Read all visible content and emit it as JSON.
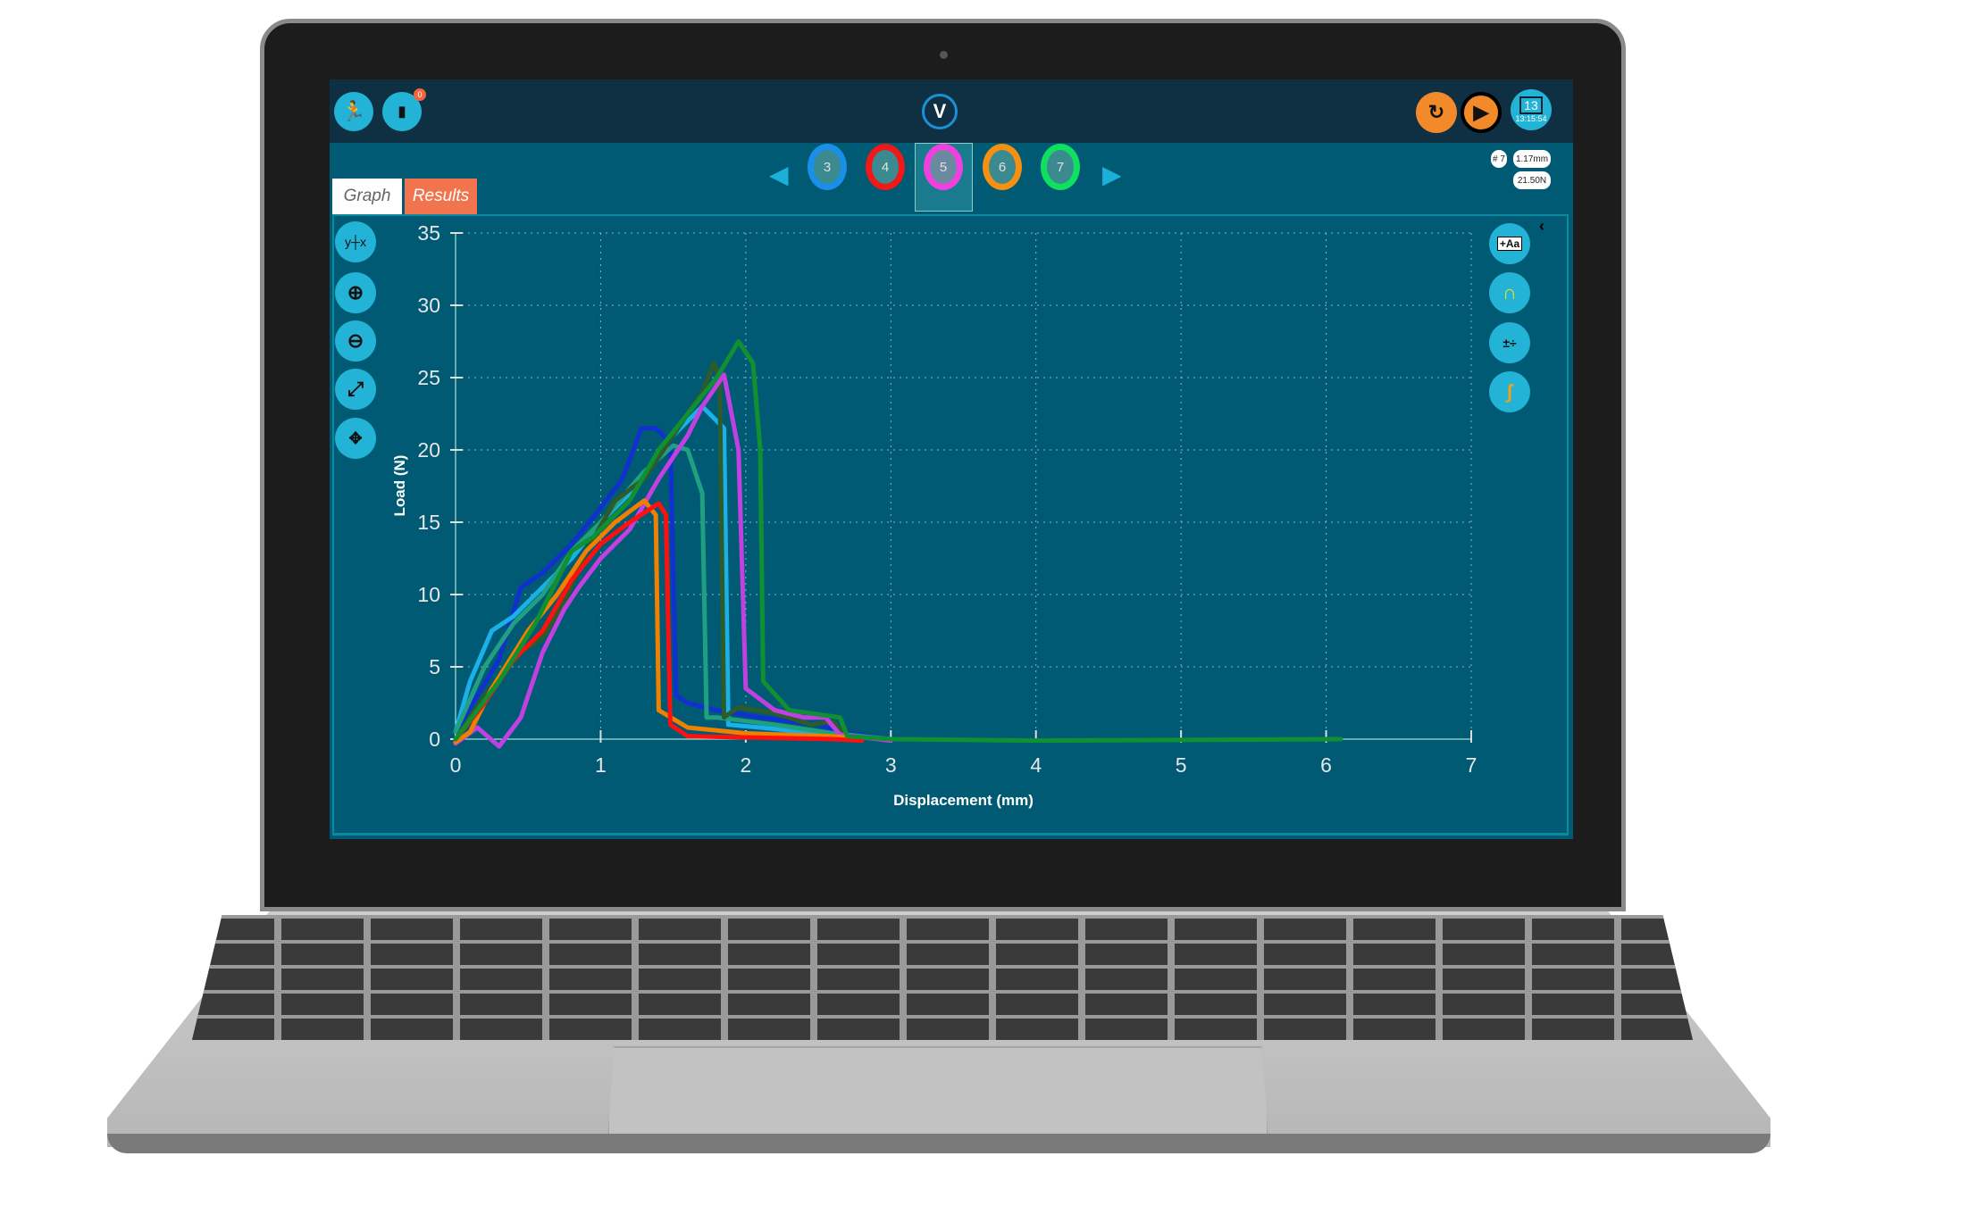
{
  "header": {
    "left_icons": [
      "exit-icon",
      "usb-device-icon"
    ],
    "notification_count": "0",
    "logo_letter": "V",
    "right_icons": [
      "reset-icon",
      "play-icon",
      "calendar-icon"
    ],
    "date_day": "13",
    "time": "13:15:54",
    "accent_orange": "#f28a2a",
    "accent_cyan": "#22b3d6"
  },
  "samples": {
    "items": [
      {
        "label": "3",
        "color": "#1a8fe8"
      },
      {
        "label": "4",
        "color": "#f01818"
      },
      {
        "label": "5",
        "color": "#f040e0",
        "selected": true
      },
      {
        "label": "6",
        "color": "#f59010"
      },
      {
        "label": "7",
        "color": "#10e060"
      }
    ]
  },
  "readout": {
    "sample": "# 7",
    "displacement": "1.17mm",
    "load": "21.50N"
  },
  "tabs": [
    {
      "label": "Graph",
      "active": true
    },
    {
      "label": "Results",
      "active": false
    }
  ],
  "left_tools": [
    "axis-select-icon",
    "zoom-in-icon",
    "zoom-out-icon",
    "fit-expand-icon",
    "pan-icon"
  ],
  "right_tools": [
    "annotate-text-icon",
    "curve-fit-icon",
    "calculator-icon",
    "overlay-curves-icon"
  ],
  "chart_data": {
    "type": "line",
    "xlabel": "Displacement (mm)",
    "ylabel": "Load (N)",
    "xlim": [
      0,
      7
    ],
    "ylim": [
      0,
      35
    ],
    "xticks": [
      0,
      1,
      2,
      3,
      4,
      5,
      6,
      7
    ],
    "yticks": [
      0,
      5,
      10,
      15,
      20,
      25,
      30,
      35
    ],
    "grid": true,
    "series": [
      {
        "color": "#1030d0",
        "points": [
          [
            0,
            0.5
          ],
          [
            0.15,
            3
          ],
          [
            0.3,
            5.5
          ],
          [
            0.45,
            10.5
          ],
          [
            0.6,
            11.5
          ],
          [
            0.8,
            13.5
          ],
          [
            1.0,
            16
          ],
          [
            1.15,
            18
          ],
          [
            1.28,
            21.5
          ],
          [
            1.38,
            21.5
          ],
          [
            1.48,
            20.5
          ],
          [
            1.52,
            3
          ],
          [
            1.6,
            2.5
          ],
          [
            1.8,
            2
          ],
          [
            2.1,
            1.5
          ],
          [
            2.5,
            1
          ],
          [
            2.65,
            0.5
          ],
          [
            3,
            0
          ]
        ]
      },
      {
        "color": "#1ab0e8",
        "points": [
          [
            0,
            0.5
          ],
          [
            0.1,
            4
          ],
          [
            0.25,
            7.5
          ],
          [
            0.4,
            8.5
          ],
          [
            0.6,
            10.5
          ],
          [
            0.8,
            12.5
          ],
          [
            1.0,
            15
          ],
          [
            1.2,
            17
          ],
          [
            1.5,
            21
          ],
          [
            1.7,
            23
          ],
          [
            1.85,
            21.5
          ],
          [
            1.88,
            1
          ],
          [
            2.1,
            0.8
          ],
          [
            2.6,
            0.3
          ],
          [
            3,
            0
          ]
        ]
      },
      {
        "color": "#20a080",
        "points": [
          [
            0,
            0.5
          ],
          [
            0.2,
            5
          ],
          [
            0.4,
            8
          ],
          [
            0.6,
            10
          ],
          [
            0.8,
            13
          ],
          [
            1.0,
            15
          ],
          [
            1.3,
            18.5
          ],
          [
            1.5,
            20.3
          ],
          [
            1.6,
            20
          ],
          [
            1.7,
            17
          ],
          [
            1.73,
            1.5
          ],
          [
            1.8,
            1.5
          ],
          [
            2.2,
            1
          ],
          [
            2.6,
            0.4
          ],
          [
            3,
            0
          ]
        ]
      },
      {
        "color": "#2f5a2a",
        "points": [
          [
            0,
            0
          ],
          [
            0.2,
            3
          ],
          [
            0.45,
            6
          ],
          [
            0.6,
            7
          ],
          [
            0.75,
            9.5
          ],
          [
            0.9,
            13
          ],
          [
            1.1,
            16.5
          ],
          [
            1.3,
            18
          ],
          [
            1.5,
            21
          ],
          [
            1.7,
            24
          ],
          [
            1.78,
            26
          ],
          [
            1.82,
            25
          ],
          [
            1.85,
            1.5
          ],
          [
            1.95,
            2.2
          ],
          [
            2.2,
            1.8
          ],
          [
            2.45,
            1
          ],
          [
            2.6,
            1.2
          ],
          [
            2.7,
            0.2
          ]
        ]
      },
      {
        "color": "#c040e0",
        "points": [
          [
            0,
            -0.3
          ],
          [
            0.15,
            0.8
          ],
          [
            0.3,
            -0.5
          ],
          [
            0.45,
            1.5
          ],
          [
            0.6,
            6
          ],
          [
            0.75,
            9
          ],
          [
            0.85,
            10.5
          ],
          [
            1.0,
            12.5
          ],
          [
            1.2,
            14.5
          ],
          [
            1.4,
            18
          ],
          [
            1.6,
            21
          ],
          [
            1.7,
            23
          ],
          [
            1.85,
            25.2
          ],
          [
            1.95,
            20
          ],
          [
            2.0,
            3.5
          ],
          [
            2.2,
            2
          ],
          [
            2.4,
            1.5
          ],
          [
            2.55,
            1.5
          ],
          [
            2.65,
            0.3
          ],
          [
            3,
            -0.1
          ]
        ]
      },
      {
        "color": "#f08000",
        "points": [
          [
            0,
            -0.2
          ],
          [
            0.1,
            0.5
          ],
          [
            0.25,
            3.5
          ],
          [
            0.5,
            7.5
          ],
          [
            0.7,
            10
          ],
          [
            0.9,
            13
          ],
          [
            1.1,
            15
          ],
          [
            1.3,
            16.5
          ],
          [
            1.38,
            15.5
          ],
          [
            1.4,
            2
          ],
          [
            1.6,
            0.8
          ],
          [
            2.0,
            0.4
          ],
          [
            2.6,
            0.2
          ],
          [
            2.8,
            0
          ]
        ]
      },
      {
        "color": "#ff1010",
        "points": [
          [
            0,
            0
          ],
          [
            0.2,
            2.5
          ],
          [
            0.4,
            5.5
          ],
          [
            0.6,
            7.5
          ],
          [
            0.8,
            11
          ],
          [
            1.0,
            13.5
          ],
          [
            1.2,
            15
          ],
          [
            1.4,
            16.3
          ],
          [
            1.45,
            15.5
          ],
          [
            1.48,
            1
          ],
          [
            1.6,
            0.2
          ],
          [
            2.6,
            0
          ],
          [
            2.8,
            -0.1
          ]
        ]
      },
      {
        "color": "#109030",
        "points": [
          [
            0,
            0
          ],
          [
            0.3,
            4
          ],
          [
            0.55,
            8
          ],
          [
            0.8,
            13
          ],
          [
            0.95,
            14
          ],
          [
            1.2,
            16.5
          ],
          [
            1.4,
            20
          ],
          [
            1.6,
            22.5
          ],
          [
            1.8,
            25
          ],
          [
            1.95,
            27.5
          ],
          [
            2.05,
            26
          ],
          [
            2.1,
            20
          ],
          [
            2.12,
            4
          ],
          [
            2.3,
            2
          ],
          [
            2.65,
            1.5
          ],
          [
            2.7,
            0.2
          ],
          [
            3,
            0
          ],
          [
            4,
            -0.1
          ],
          [
            6.1,
            0
          ]
        ]
      }
    ]
  }
}
